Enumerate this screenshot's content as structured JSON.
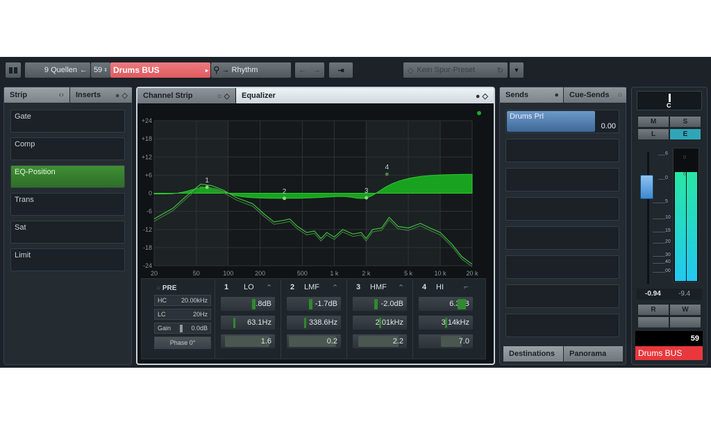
{
  "toolbar": {
    "sources": "9 Quellen",
    "track_number": "59",
    "track_name": "Drums BUS",
    "output": "Rhythm",
    "preset": "Kein Spur-Preset"
  },
  "left": {
    "tabs": [
      {
        "label": "Strip"
      },
      {
        "label": "Inserts"
      }
    ],
    "items": [
      {
        "label": "Gate"
      },
      {
        "label": "Comp"
      },
      {
        "label": "EQ-Position",
        "active": true
      },
      {
        "label": "Trans"
      },
      {
        "label": "Sat"
      },
      {
        "label": "Limit"
      }
    ]
  },
  "eq_panel": {
    "tabs": [
      {
        "label": "Channel Strip"
      },
      {
        "label": "Equalizer"
      }
    ],
    "pre": {
      "label": "PRE",
      "hc_label": "HC",
      "hc": "20.00kHz",
      "lc_label": "LC",
      "lc": "20Hz",
      "gain_label": "Gain",
      "gain": "0.0dB",
      "phase": "Phase 0°"
    },
    "bands": [
      {
        "num": "1",
        "name": "LO",
        "gain": "2.8dB",
        "freq": "63.1Hz",
        "q": "1.6",
        "gain_db": 2.8,
        "freq_hz": 63.1,
        "q_val": 1.6,
        "type": "peak"
      },
      {
        "num": "2",
        "name": "LMF",
        "gain": "-1.7dB",
        "freq": "338.6Hz",
        "q": "0.2",
        "gain_db": -1.7,
        "freq_hz": 338.6,
        "q_val": 0.2,
        "type": "peak"
      },
      {
        "num": "3",
        "name": "HMF",
        "gain": "-2.0dB",
        "freq": "2.01kHz",
        "q": "2.2",
        "gain_db": -2.0,
        "freq_hz": 2010,
        "q_val": 2.2,
        "type": "peak"
      },
      {
        "num": "4",
        "name": "HI",
        "gain": "6.3dB",
        "freq": "3.14kHz",
        "q": "7.0",
        "gain_db": 6.3,
        "freq_hz": 3140,
        "q_val": 7.0,
        "type": "shelf"
      }
    ]
  },
  "chart_data": {
    "type": "line",
    "xscale": "log",
    "xlim": [
      20,
      20000
    ],
    "ylim": [
      -24,
      24
    ],
    "x_ticks": [
      "20",
      "50",
      "100",
      "200",
      "500",
      "1 k",
      "2 k",
      "5 k",
      "10 k",
      "20 k"
    ],
    "x_tick_values": [
      20,
      50,
      100,
      200,
      500,
      1000,
      2000,
      5000,
      10000,
      20000
    ],
    "y_ticks": [
      "+24",
      "+18",
      "+12",
      "+6",
      "0",
      "-6",
      "-12",
      "-18",
      "-24"
    ],
    "y_tick_values": [
      24,
      18,
      12,
      6,
      0,
      -6,
      -12,
      -18,
      -24
    ],
    "spectrum": [
      [
        20,
        -8.5
      ],
      [
        30,
        -5
      ],
      [
        40,
        -1
      ],
      [
        55,
        3
      ],
      [
        70,
        2.5
      ],
      [
        90,
        1
      ],
      [
        120,
        -1.5
      ],
      [
        170,
        -3.5
      ],
      [
        220,
        -7
      ],
      [
        270,
        -9.5
      ],
      [
        330,
        -9
      ],
      [
        380,
        -8.5
      ],
      [
        450,
        -11
      ],
      [
        550,
        -13
      ],
      [
        650,
        -12.5
      ],
      [
        750,
        -15
      ],
      [
        850,
        -13
      ],
      [
        1000,
        -14.5
      ],
      [
        1200,
        -12
      ],
      [
        1500,
        -13.5
      ],
      [
        1800,
        -13
      ],
      [
        2000,
        -15
      ],
      [
        2300,
        -12
      ],
      [
        2800,
        -11.5
      ],
      [
        3300,
        -8
      ],
      [
        4000,
        -11
      ],
      [
        5000,
        -11.5
      ],
      [
        6500,
        -10
      ],
      [
        8000,
        -11.5
      ],
      [
        10000,
        -13
      ],
      [
        13000,
        -17
      ],
      [
        16000,
        -21
      ],
      [
        20000,
        -23.5
      ]
    ],
    "grid": true
  },
  "sends": {
    "tabs": [
      {
        "label": "Sends"
      },
      {
        "label": "Cue-Sends"
      }
    ],
    "first": {
      "name": "Drums Prl",
      "value": "0.00"
    },
    "bottom_tabs": [
      {
        "label": "Destinations"
      },
      {
        "label": "Panorama"
      }
    ]
  },
  "channel": {
    "pan": "C",
    "m": "M",
    "s": "S",
    "l": "L",
    "e": "E",
    "fader_scale": [
      "6",
      "0",
      "5",
      "10",
      "15",
      "20",
      "30",
      "40",
      "00"
    ],
    "meter_scale": [
      "0",
      "6"
    ],
    "fader_value": "-0.94",
    "peak_value": "-9.4",
    "r": "R",
    "w": "W",
    "number": "59",
    "name": "Drums BUS",
    "meter_level": 0.82,
    "colors": {
      "track": "#e8383d",
      "meter": "#25d6b0",
      "edit": "#2fa6b8"
    }
  }
}
